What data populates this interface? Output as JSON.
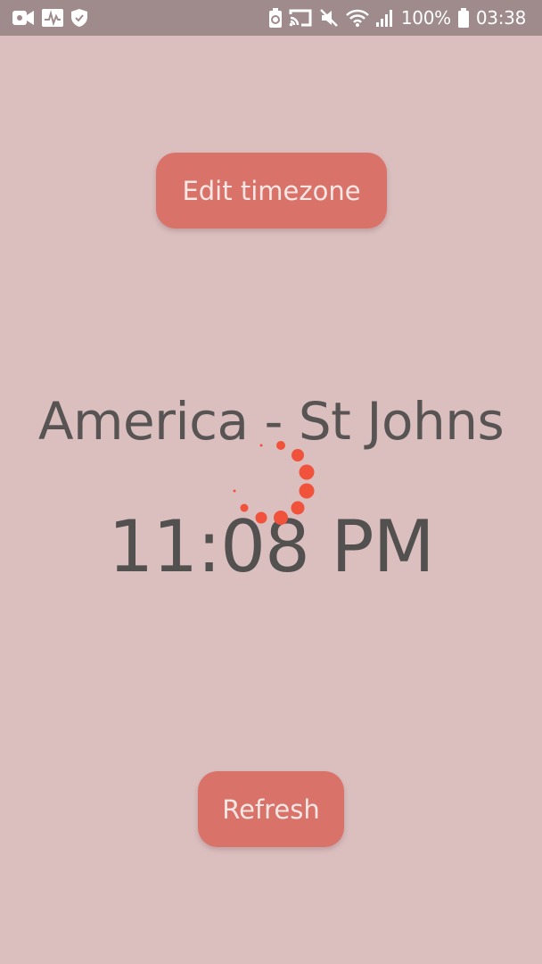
{
  "status_bar": {
    "battery_percent": "100%",
    "clock": "03:38",
    "left_icons": [
      "video-camera-icon",
      "activity-monitor-icon",
      "shield-icon"
    ],
    "right_icons": [
      "battery-saver-icon",
      "cast-icon",
      "mute-icon",
      "wifi-icon",
      "signal-icon",
      "battery-icon"
    ]
  },
  "edit_button": {
    "label": "Edit timezone"
  },
  "timezone": {
    "name": "America - St Johns"
  },
  "clock": {
    "time": "11:08 PM"
  },
  "refresh_button": {
    "label": "Refresh"
  },
  "theme": {
    "background": "#dbbfbf",
    "status_bar_bg": "#9f8b8b",
    "button_bg": "#d9736a",
    "spinner": "#f0523b"
  }
}
